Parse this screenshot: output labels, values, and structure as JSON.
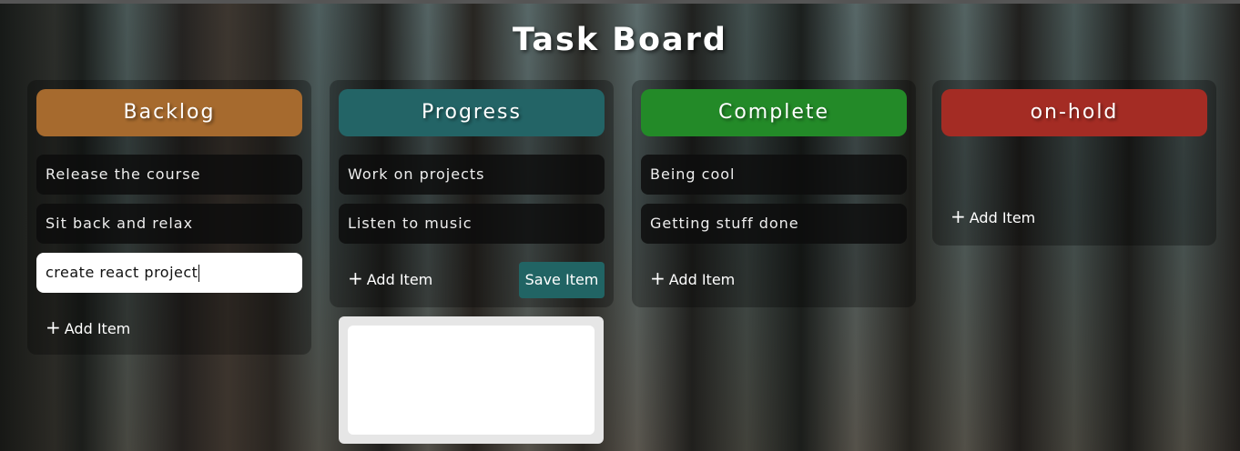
{
  "board": {
    "title": "Task Board"
  },
  "columns": [
    {
      "name": "Backlog",
      "color": "#a66a2e",
      "items": [
        "Release the course",
        "Sit back and relax"
      ],
      "input_value": "create  react project",
      "add_label": "Add Item"
    },
    {
      "name": "Progress",
      "color": "#236466",
      "items": [
        "Work on projects",
        "Listen to music"
      ],
      "add_label": "Add Item",
      "save_label": "Save Item"
    },
    {
      "name": "Complete",
      "color": "#238a28",
      "items": [
        "Being cool",
        "Getting stuff done"
      ],
      "add_label": "Add Item"
    },
    {
      "name": "on-hold",
      "color": "#a42c24",
      "items": [],
      "add_label": "Add Item"
    }
  ],
  "icons": {
    "add": "plus-icon"
  }
}
